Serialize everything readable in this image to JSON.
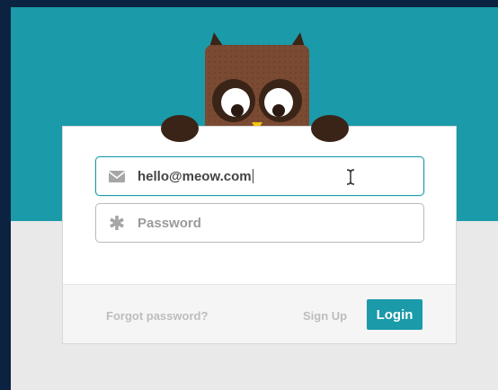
{
  "login_form": {
    "email": {
      "icon": "envelope-icon",
      "value": "hello@meow.com",
      "placeholder": ""
    },
    "password": {
      "icon": "asterisk-icon",
      "value": "",
      "placeholder": "Password"
    }
  },
  "footer": {
    "forgot_label": "Forgot password?",
    "signup_label": "Sign Up",
    "login_label": "Login"
  },
  "colors": {
    "teal_accent": "#1b9aaa",
    "owl_brown": "#7a4a32",
    "owl_dark": "#3a2417",
    "beak_yellow": "#f4c20d"
  }
}
